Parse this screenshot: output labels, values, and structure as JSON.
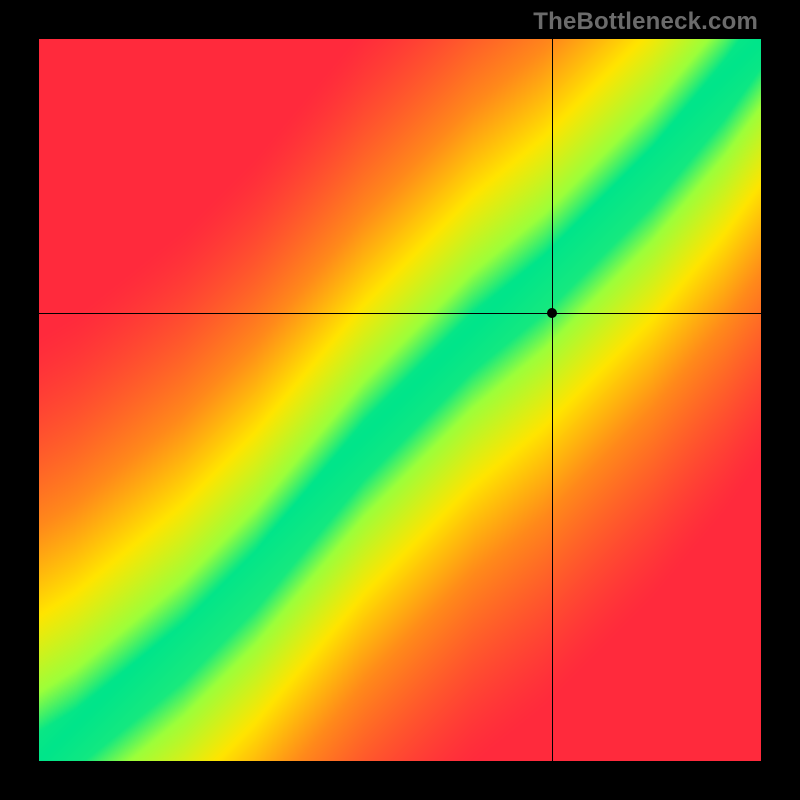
{
  "watermark": "TheBottleneck.com",
  "chart_data": {
    "type": "heatmap",
    "title": "",
    "xlabel": "",
    "ylabel": "",
    "xlim": [
      0,
      100
    ],
    "ylim": [
      0,
      100
    ],
    "grid": false,
    "legend": false,
    "marker": {
      "x": 71,
      "y": 62
    },
    "crosshair": {
      "x": 71,
      "y": 62
    },
    "colorscale": [
      {
        "value": 0.0,
        "color": "#ff2a3c"
      },
      {
        "value": 0.35,
        "color": "#ff8a1a"
      },
      {
        "value": 0.6,
        "color": "#ffe500"
      },
      {
        "value": 0.85,
        "color": "#9cff3a"
      },
      {
        "value": 1.0,
        "color": "#00e58a"
      }
    ],
    "ridge": {
      "description": "optimal diagonal band; curve y≈x with slight S-profile; band width ≈8% of axis",
      "points_xy_pct": [
        [
          0,
          0
        ],
        [
          5,
          3
        ],
        [
          10,
          7
        ],
        [
          15,
          11
        ],
        [
          20,
          15
        ],
        [
          25,
          20
        ],
        [
          30,
          25
        ],
        [
          35,
          31
        ],
        [
          40,
          37
        ],
        [
          45,
          43
        ],
        [
          50,
          48
        ],
        [
          55,
          53
        ],
        [
          60,
          58
        ],
        [
          65,
          62
        ],
        [
          70,
          66
        ],
        [
          75,
          71
        ],
        [
          80,
          76
        ],
        [
          85,
          81
        ],
        [
          90,
          87
        ],
        [
          95,
          93
        ],
        [
          100,
          100
        ]
      ],
      "band_halfwidth_pct": 4
    }
  }
}
